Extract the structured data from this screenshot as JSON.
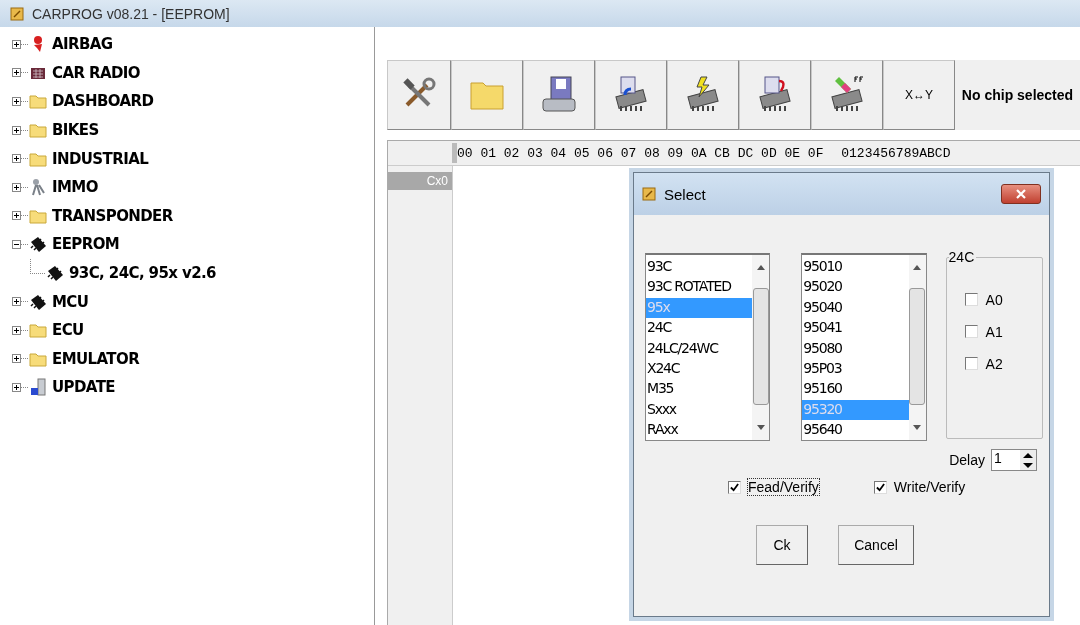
{
  "window": {
    "title": "CARPROG  v08.21 - [EEPROM]"
  },
  "tree": [
    {
      "label": "AIRBAG",
      "kind": "airbag",
      "expanded": false
    },
    {
      "label": "CAR RADIO",
      "kind": "radio",
      "expanded": false
    },
    {
      "label": "DASHBOARD",
      "kind": "folder",
      "expanded": false
    },
    {
      "label": "BIKES",
      "kind": "folder",
      "expanded": false
    },
    {
      "label": "INDUSTRIAL",
      "kind": "folder",
      "expanded": false
    },
    {
      "label": "IMMO",
      "kind": "keys",
      "expanded": false
    },
    {
      "label": "TRANSPONDER",
      "kind": "folder",
      "expanded": false
    },
    {
      "label": "EEPROM",
      "kind": "chip",
      "expanded": true,
      "children": [
        {
          "label": "93C, 24C, 95x v2.6",
          "kind": "chip"
        }
      ]
    },
    {
      "label": "MCU",
      "kind": "chip",
      "expanded": false
    },
    {
      "label": "ECU",
      "kind": "folder",
      "expanded": false
    },
    {
      "label": "EMULATOR",
      "kind": "folder",
      "expanded": false
    },
    {
      "label": "UPDATE",
      "kind": "update",
      "expanded": false
    }
  ],
  "toolbar": [
    {
      "kind": "tools"
    },
    {
      "kind": "folder"
    },
    {
      "kind": "save"
    },
    {
      "kind": "read"
    },
    {
      "kind": "write"
    },
    {
      "kind": "verify"
    },
    {
      "kind": "erase"
    },
    {
      "kind": "text",
      "label": "X↔Y"
    }
  ],
  "chip_status": "No chip selected",
  "hex_header": [
    "00",
    "01",
    "02",
    "03",
    "04",
    "05",
    "06",
    "07",
    "08",
    "09",
    "0A",
    "CB",
    "DC",
    "0D",
    "0E",
    "0F"
  ],
  "ascii_header": "0123456789ABCD",
  "address": "Cx0",
  "dialog": {
    "title": "Select",
    "family_list": [
      {
        "label": "93C",
        "selected": false
      },
      {
        "label": "93C ROTATED",
        "selected": false
      },
      {
        "label": "95x",
        "selected": true
      },
      {
        "label": "24C",
        "selected": false
      },
      {
        "label": "24LC/24WC",
        "selected": false
      },
      {
        "label": "X24C",
        "selected": false
      },
      {
        "label": "M35",
        "selected": false
      },
      {
        "label": "Sxxx",
        "selected": false
      },
      {
        "label": "RAxx",
        "selected": false
      }
    ],
    "chip_list": [
      {
        "label": "95010",
        "selected": false
      },
      {
        "label": "95020",
        "selected": false
      },
      {
        "label": "95040",
        "selected": false
      },
      {
        "label": "95041",
        "selected": false
      },
      {
        "label": "95080",
        "selected": false
      },
      {
        "label": "95P03",
        "selected": false
      },
      {
        "label": "95160",
        "selected": false
      },
      {
        "label": "95320",
        "selected": true
      },
      {
        "label": "95640",
        "selected": false
      }
    ],
    "group": {
      "title": "24C",
      "options": [
        {
          "label": "A0",
          "checked": false
        },
        {
          "label": "A1",
          "checked": false
        },
        {
          "label": "A2",
          "checked": false
        }
      ]
    },
    "delay": {
      "label": "Delay",
      "value": "1"
    },
    "options": [
      {
        "label": "Fead/Verify",
        "checked": true
      },
      {
        "label": "Write/Verify",
        "checked": true
      }
    ],
    "buttons": [
      "Ck",
      "Cancel"
    ]
  }
}
